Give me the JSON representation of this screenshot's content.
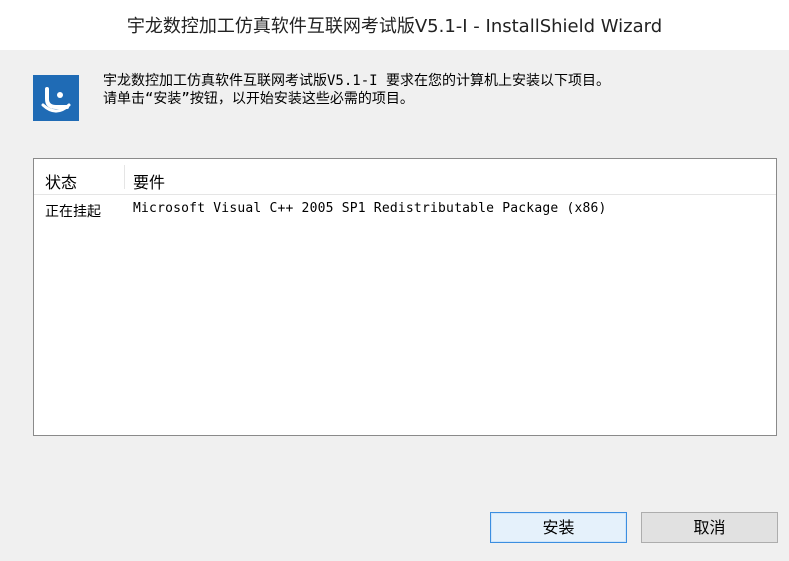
{
  "window": {
    "title": "宇龙数控加工仿真软件互联网考试版V5.1-I - InstallShield Wizard"
  },
  "message": {
    "line1": "宇龙数控加工仿真软件互联网考试版V5.1-I 要求在您的计算机上安装以下项目。",
    "line2": "请单击“安装”按钮，以开始安装这些必需的项目。"
  },
  "list": {
    "headers": {
      "status": "状态",
      "requirement": "要件"
    },
    "rows": [
      {
        "status": "正在挂起",
        "requirement": "Microsoft Visual C++ 2005 SP1 Redistributable Package (x86)"
      }
    ]
  },
  "buttons": {
    "install": "安装",
    "cancel": "取消"
  },
  "icons": {
    "app": "installshield-app-icon"
  },
  "colors": {
    "icon_blue": "#1f6bb5",
    "primary_border": "#3c8ee0"
  }
}
